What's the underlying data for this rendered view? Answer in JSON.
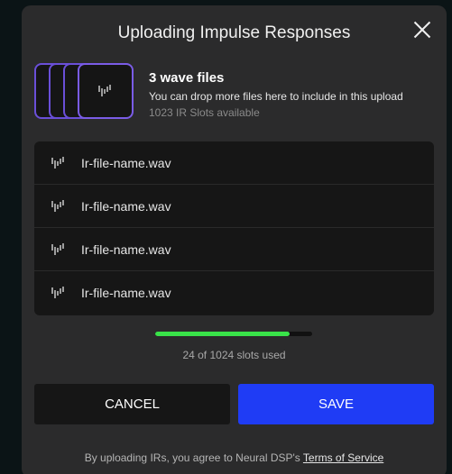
{
  "dialog": {
    "title": "Uploading Impulse Responses",
    "close_icon": "close-icon"
  },
  "upload": {
    "file_count": "3 wave files",
    "drop_hint": "You can drop more files here to include in this upload",
    "slots_available": "1023 IR Slots available",
    "file_icon": "waveform-icon"
  },
  "files": [
    {
      "name": "Ir-file-name.wav"
    },
    {
      "name": "Ir-file-name.wav"
    },
    {
      "name": "Ir-file-name.wav"
    },
    {
      "name": "Ir-file-name.wav"
    }
  ],
  "usage": {
    "progress_fraction": 0.856,
    "label": "24 of 1024 slots used"
  },
  "buttons": {
    "cancel": "CANCEL",
    "save": "SAVE"
  },
  "footer": {
    "prefix": "By uploading IRs, you agree to Neural DSP's ",
    "link": "Terms of Service"
  },
  "colors": {
    "accent": "#1f3cf5",
    "progress": "#39e349",
    "card_border": "#7a5ce6"
  }
}
